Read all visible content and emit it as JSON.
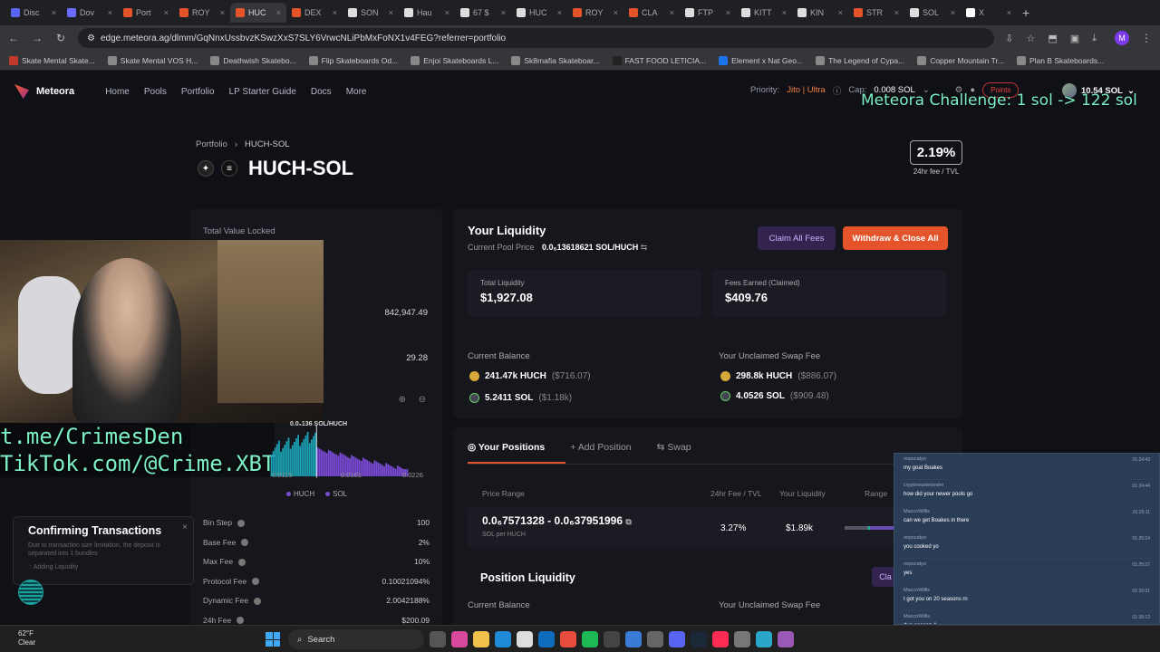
{
  "browser": {
    "tabs": [
      {
        "label": "Disc",
        "color": "#5865f2"
      },
      {
        "label": "Dov",
        "color": "#6b6bff"
      },
      {
        "label": "Port",
        "color": "#e4532a"
      },
      {
        "label": "ROY",
        "color": "#e4532a"
      },
      {
        "label": "HUC",
        "color": "#e4532a",
        "active": true
      },
      {
        "label": "DEX",
        "color": "#e4532a"
      },
      {
        "label": "SON",
        "color": "#ddd"
      },
      {
        "label": "Hau",
        "color": "#ddd"
      },
      {
        "label": "67 $",
        "color": "#ddd"
      },
      {
        "label": "HUC",
        "color": "#ddd"
      },
      {
        "label": "ROY",
        "color": "#e4532a"
      },
      {
        "label": "CLA",
        "color": "#e4532a"
      },
      {
        "label": "FTP",
        "color": "#ddd"
      },
      {
        "label": "KITT",
        "color": "#ddd"
      },
      {
        "label": "KIN",
        "color": "#ddd"
      },
      {
        "label": "STR",
        "color": "#e4532a"
      },
      {
        "label": "SOL",
        "color": "#ddd"
      },
      {
        "label": "X",
        "color": "#fff"
      }
    ],
    "url": "edge.meteora.ag/dlmm/GqNnxUssbvzKSwzXxS7SLY6VrwcNLiPbMxFoNX1v4FEG?referrer=portfolio",
    "bookmarks": [
      "Skate Mental Skate...",
      "Skate Mental VOS H...",
      "Deathwish Skatebo...",
      "Flip Skateboards Od...",
      "Enjoi Skateboards L...",
      "Sk8mafia Skateboar...",
      "FAST FOOD LETICIA...",
      "Element x Nat Geo...",
      "The Legend of Cypa...",
      "Copper Mountain Tr...",
      "Plan B Skateboards..."
    ]
  },
  "nav": {
    "brand": "Meteora",
    "menu": [
      "Home",
      "Pools",
      "Portfolio",
      "LP Starter Guide",
      "Docs",
      "More"
    ],
    "priority_label": "Priority:",
    "priority_value": "Jito | Ultra",
    "cap_label": "Cap:",
    "cap_value": "0.008 SOL",
    "points": "Points",
    "wallet": "10.54 SOL"
  },
  "stream_overlay": {
    "challenge": "Meteora Challenge: 1 sol -> 122 sol",
    "link1": "t.me/CrimesDen",
    "link2": "TikTok.com/@Crime.XBT"
  },
  "pool": {
    "breadcrumb_parent": "Portfolio",
    "breadcrumb_current": "HUCH-SOL",
    "title": "HUCH-SOL",
    "fee_tvl_value": "2.19%",
    "fee_tvl_label": "24hr fee / TVL"
  },
  "left_panel": {
    "tvl_label": "Total Value Locked",
    "value1": "842,947.49",
    "value2": "29.28",
    "price_marker": "0.0₆136 SOL/HUCH",
    "axis": [
      "0.0115",
      "0.0161",
      "0.0226"
    ],
    "legend": [
      "HUCH",
      "SOL"
    ],
    "params": [
      {
        "k": "Bin Step",
        "v": "100"
      },
      {
        "k": "Base Fee",
        "v": "2%"
      },
      {
        "k": "Max Fee",
        "v": "10%"
      },
      {
        "k": "Protocol Fee",
        "v": "0.10021094%"
      },
      {
        "k": "Dynamic Fee",
        "v": "2.0042188%"
      },
      {
        "k": "24h Fee",
        "v": "$200.09"
      }
    ]
  },
  "toast": {
    "title": "Confirming Transactions",
    "desc": "Due to transaction size limitation, the deposit is separated into 1 bundles",
    "status": "Adding Liquidity"
  },
  "liquidity": {
    "title": "Your Liquidity",
    "pool_price_label": "Current Pool Price",
    "pool_price": "0.0₆13618621 SOL/HUCH",
    "claim_btn": "Claim All Fees",
    "withdraw_btn": "Withdraw & Close All",
    "total_label": "Total Liquidity",
    "total_value": "$1,927.08",
    "fees_label": "Fees Earned (Claimed)",
    "fees_value": "$409.76",
    "balance_label": "Current Balance",
    "balance_huch": "241.47k HUCH",
    "balance_huch_usd": "($716.07)",
    "balance_sol": "5.2411 SOL",
    "balance_sol_usd": "($1.18k)",
    "unclaimed_label": "Your Unclaimed Swap Fee",
    "unclaimed_huch": "298.8k HUCH",
    "unclaimed_huch_usd": "($886.07)",
    "unclaimed_sol": "4.0526 SOL",
    "unclaimed_sol_usd": "($909.48)"
  },
  "positions": {
    "tabs": [
      "Your Positions",
      "Add Position",
      "Swap"
    ],
    "headers": [
      "Price Range",
      "24hr Fee / TVL",
      "Your Liquidity",
      "Range"
    ],
    "row_range": "0.0₆7571328 - 0.0₆37951996",
    "row_unit": "SOL per HUCH",
    "row_fee": "3.27%",
    "row_liq": "$1.89k",
    "position_liquidity": "Position Liquidity",
    "current_balance": "Current Balance",
    "unclaimed": "Your Unclaimed Swap Fee",
    "claim_short": "Cla"
  },
  "chat": [
    {
      "user": "oopscatyo",
      "text": "my goat Boakes",
      "ts": "01:24:43"
    },
    {
      "user": "cryptowastelander",
      "text": "how did your newer pools go",
      "ts": "01:24:44"
    },
    {
      "user": "MaccoWillis",
      "text": "can we get Boakes in there",
      "ts": "01:25:11"
    },
    {
      "user": "oopscatyo",
      "text": "you cooked yo",
      "ts": "01:25:24"
    },
    {
      "user": "oopscatyo",
      "text": "yes",
      "ts": "01:25:27"
    },
    {
      "user": "MaccoWillis",
      "text": "I got you on 20 seasons rn",
      "ts": "01:26:01"
    },
    {
      "user": "MaccoWillis",
      "text": "dua season 4",
      "ts": "01:26:12"
    },
    {
      "user": "oopscatyo",
      "text": "",
      "ts": ""
    }
  ],
  "taskbar": {
    "temp": "62°F",
    "condition": "Clear",
    "search": "Search"
  },
  "chart_data": {
    "type": "bar",
    "series": [
      {
        "name": "HUCH",
        "color": "#1aa1b4"
      },
      {
        "name": "SOL",
        "color": "#7b4bd8"
      }
    ],
    "bars_left": 24,
    "bars_right": 48
  }
}
